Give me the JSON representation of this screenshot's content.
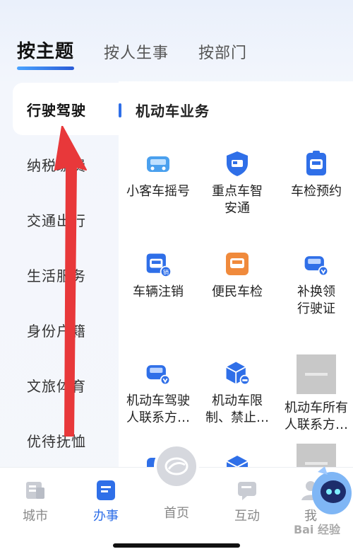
{
  "top_tabs": [
    "按主题",
    "按人生事",
    "按部门"
  ],
  "sidebar": {
    "items": [
      "行驶驾驶",
      "纳税缴费",
      "交通出行",
      "生活服务",
      "身份户籍",
      "文旅体育",
      "优待抚恤"
    ]
  },
  "section": {
    "title": "机动车业务"
  },
  "services": [
    {
      "label": "小客车摇号",
      "icon": "car-icon"
    },
    {
      "label": "重点车智\n安通",
      "icon": "shield-truck-icon"
    },
    {
      "label": "车检预约",
      "icon": "clipboard-car-icon"
    },
    {
      "label": "车辆注销",
      "icon": "car-cancel-icon",
      "badge": "销"
    },
    {
      "label": "便民车检",
      "icon": "car-check-icon"
    },
    {
      "label": "补换领\n行驶证",
      "icon": "car-license-icon"
    },
    {
      "label": "机动车驾驶\n人联系方…",
      "icon": "car-driver-contact-icon"
    },
    {
      "label": "机动车限\n制、禁止…",
      "icon": "cube-restriction-icon"
    },
    {
      "label": "机动车所有\n人联系方…",
      "icon": "image-placeholder"
    }
  ],
  "bottom_nav": [
    {
      "label": "城市",
      "icon": "city-icon"
    },
    {
      "label": "办事",
      "icon": "clipboard-icon",
      "active": true
    },
    {
      "label": "首页",
      "icon": "home-logo-icon"
    },
    {
      "label": "互动",
      "icon": "chat-icon"
    },
    {
      "label": "我",
      "icon": "user-icon"
    }
  ],
  "watermark": "Bai 经验",
  "colors": {
    "accent": "#2f6fe8",
    "arrow": "#e8383a",
    "icon_orange": "#f08a3c"
  }
}
